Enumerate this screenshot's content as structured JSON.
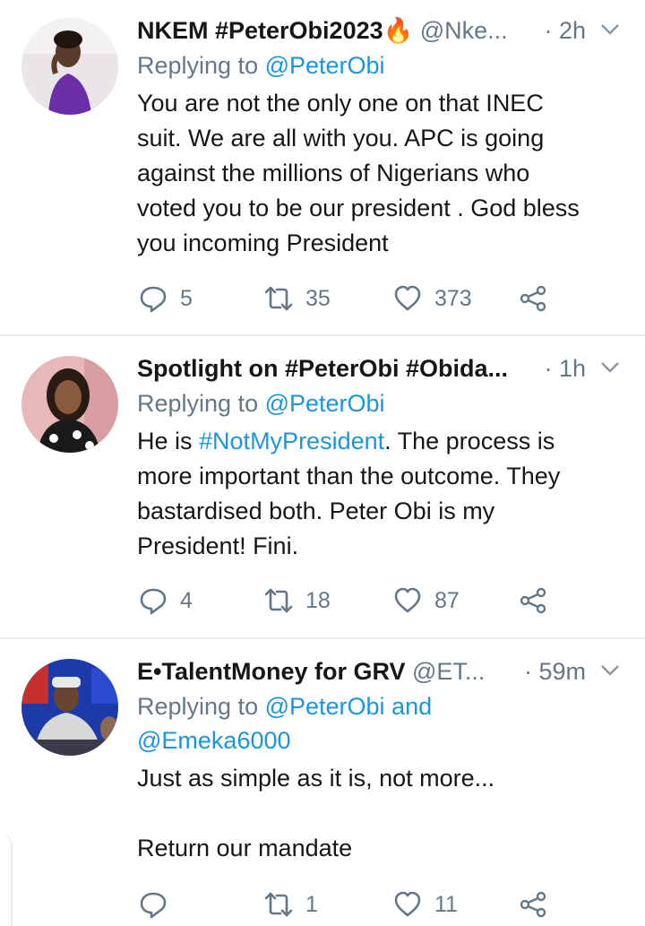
{
  "tweets": [
    {
      "name": "NKEM #PeterObi2023🔥",
      "handle": "@Nke...",
      "time": "· 2h",
      "replying_prefix": "Replying to ",
      "replying_to": "@PeterObi",
      "replying_to_2": "",
      "body": [
        "You are not the only one on that INEC",
        "suit. We are all with you. APC is going",
        "against the millions of Nigerians who",
        "voted you to be our president . God bless",
        "you incoming President"
      ],
      "replies": "5",
      "retweets": "35",
      "likes": "373"
    },
    {
      "name": "Spotlight on #PeterObi #Obida...",
      "handle": "",
      "time": "· 1h",
      "replying_prefix": "Replying to ",
      "replying_to": "@PeterObi",
      "replying_to_2": "",
      "body_prefix": "He is ",
      "body_tag": "#NotMyPresident",
      "body_suffix": ". The process is",
      "body": [
        "more important than the outcome. They",
        "bastardised both. Peter Obi is my",
        "President! Fini."
      ],
      "replies": "4",
      "retweets": "18",
      "likes": "87"
    },
    {
      "name": "E•TalentMoney for GRV",
      "handle": "@ET...",
      "time": "· 59m",
      "replying_prefix": "Replying to ",
      "replying_to": "@PeterObi and",
      "replying_to_2": "@Emeka6000",
      "body": [
        "Just as simple as it is, not more...",
        "",
        "Return our mandate"
      ],
      "replies": "",
      "retweets": "1",
      "likes": "11"
    }
  ],
  "icons": {
    "reply": "reply-icon",
    "retweet": "retweet-icon",
    "like": "like-icon",
    "share": "share-icon",
    "more": "chevron-down-icon"
  },
  "colors": {
    "text": "#14171a",
    "muted": "#657786",
    "link": "#1b95e0",
    "divider": "#e6ecf0"
  }
}
